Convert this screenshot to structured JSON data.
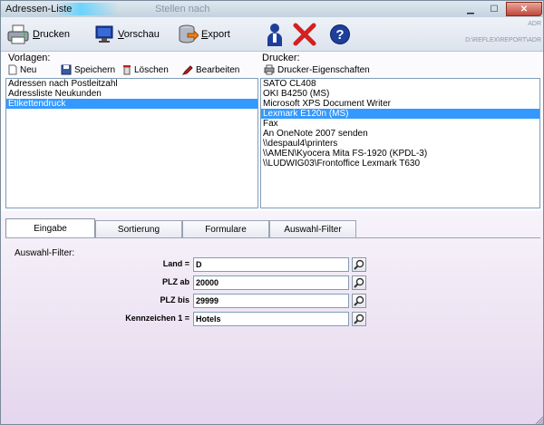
{
  "window": {
    "title": "Adressen-Liste",
    "ghost_title": "Stellen nach"
  },
  "toolbar": {
    "print_label": "Drucken",
    "print_ul": "D",
    "print_rest": "rucken",
    "preview_ul": "V",
    "preview_rest": "orschau",
    "export_ul": "E",
    "export_rest": "xport",
    "right_top": "ADR",
    "right_path": "D:\\REFLEX\\REPORT\\ADR"
  },
  "templates": {
    "label": "Vorlagen:",
    "actions": {
      "new": "Neu",
      "save": "Speichern",
      "delete": "Löschen",
      "edit": "Bearbeiten"
    },
    "items": [
      "Adressen nach Postleitzahl",
      "Adressliste Neukunden",
      "Etikettendruck"
    ],
    "selected_index": 2
  },
  "printers": {
    "label": "Drucker:",
    "properties_button": "Drucker-Eigenschaften",
    "items": [
      "SATO CL408",
      "OKI B4250 (MS)",
      "Microsoft XPS Document Writer",
      "Lexmark E120n (MS)",
      "Fax",
      "An OneNote 2007 senden",
      "\\\\despaul4\\printers",
      "\\\\AMEN\\Kyocera Mita FS-1920 (KPDL-3)",
      "\\\\LUDWIG03\\Frontoffice Lexmark T630"
    ],
    "selected_index": 3
  },
  "tabs": [
    "Eingabe",
    "Sortierung",
    "Formulare",
    "Auswahl-Filter"
  ],
  "active_tab": 0,
  "filter": {
    "label": "Auswahl-Filter:",
    "fields": [
      {
        "label": "Land =",
        "value": "D"
      },
      {
        "label": "PLZ ab",
        "value": "20000"
      },
      {
        "label": "PLZ bis",
        "value": "29999"
      },
      {
        "label": "Kennzeichen 1 =",
        "value": "Hotels"
      }
    ]
  }
}
